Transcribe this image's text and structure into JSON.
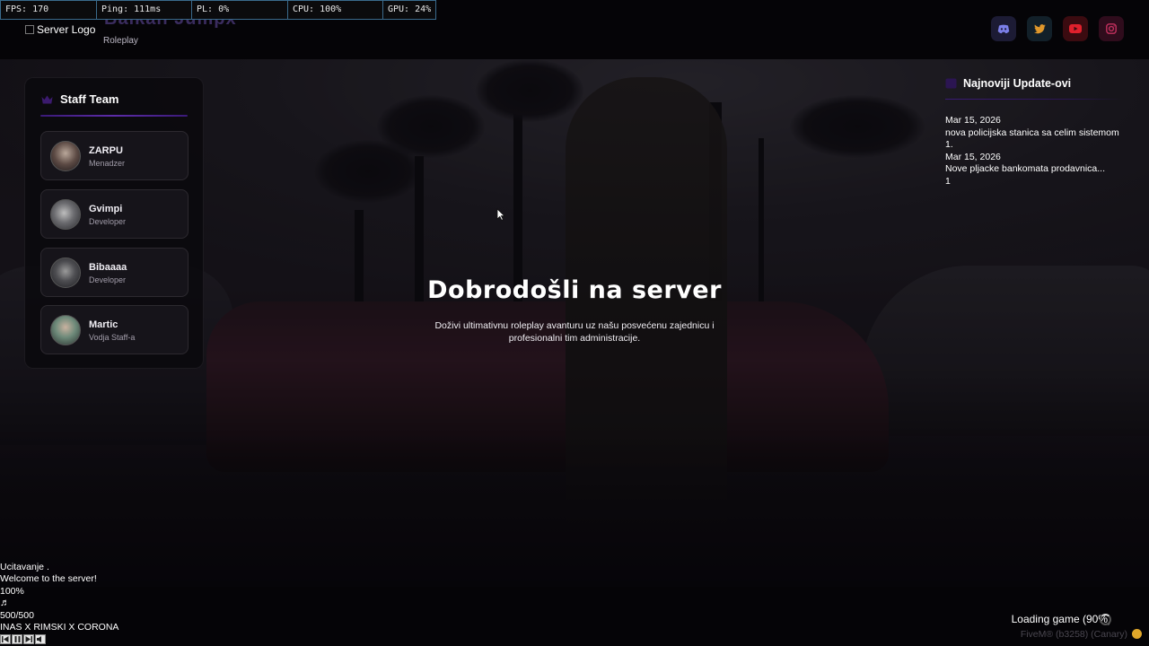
{
  "perf": {
    "fps": "FPS: 170",
    "ping": "Ping: 111ms",
    "pl": "PL: 0%",
    "cpu": "CPU: 100%",
    "gpu": "GPU: 24%"
  },
  "header": {
    "logo_alt": "Server Logo",
    "server_name": "Balkan Jumpx",
    "server_subtitle": "Roleplay",
    "socials": [
      {
        "icon": "discord-icon",
        "color": "#7b7fe8"
      },
      {
        "icon": "twitter-icon",
        "color": "#e0982b"
      },
      {
        "icon": "youtube-icon",
        "color": "#e0202c"
      },
      {
        "icon": "instagram-icon",
        "color": "#c2305e"
      }
    ]
  },
  "staff": {
    "title": "Staff Team",
    "members": [
      {
        "name": "ZARPU",
        "role": "Menadzer"
      },
      {
        "name": "Gvimpi",
        "role": "Developer"
      },
      {
        "name": "Bibaaaa",
        "role": "Developer"
      },
      {
        "name": "Martic",
        "role": "Vodja Staff-a"
      }
    ]
  },
  "updates": {
    "title": "Najnoviji Update-ovi",
    "items": [
      {
        "date": "Mar 15, 2026",
        "text": "nova policijska stanica sa celim sistemom",
        "count": "1."
      },
      {
        "date": "Mar 15, 2026",
        "text": "Nove pljacke bankomata prodavnica...",
        "count": "1"
      }
    ]
  },
  "welcome": {
    "title": "Dobrodošli na server",
    "subtitle": "Doživi ultimativnu roleplay avanturu uz našu posvećenu zajednicu i profesionalni tim administracije."
  },
  "status": {
    "loading_text": "Ucitavanje .",
    "welcome_text": "Welcome to the server!",
    "volume": "100%",
    "music_icon": "♬",
    "counter": "500/500",
    "track": "INAS X RIMSKI X CORONA"
  },
  "loader": {
    "text": "Loading game (90%)",
    "progress": 0.9,
    "build": "FiveM® (b3258) (Canary)"
  },
  "colors": {
    "accent": "#5c2ca8",
    "background": "#050407"
  }
}
